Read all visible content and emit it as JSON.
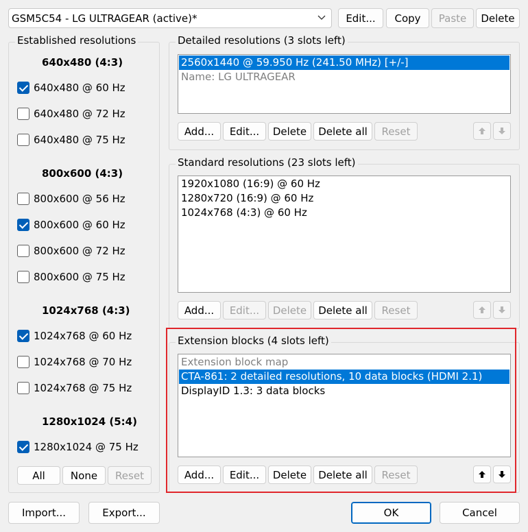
{
  "top": {
    "monitor_select": "GSM5C54 - LG ULTRAGEAR (active)*",
    "edit": "Edit...",
    "copy": "Copy",
    "paste": "Paste",
    "delete": "Delete"
  },
  "established": {
    "title": "Established resolutions",
    "groups": [
      {
        "heading": "640x480 (4:3)",
        "items": [
          {
            "label": "640x480 @ 60 Hz",
            "checked": true
          },
          {
            "label": "640x480 @ 72 Hz",
            "checked": false
          },
          {
            "label": "640x480 @ 75 Hz",
            "checked": false
          }
        ]
      },
      {
        "heading": "800x600 (4:3)",
        "items": [
          {
            "label": "800x600 @ 56 Hz",
            "checked": false
          },
          {
            "label": "800x600 @ 60 Hz",
            "checked": true
          },
          {
            "label": "800x600 @ 72 Hz",
            "checked": false
          },
          {
            "label": "800x600 @ 75 Hz",
            "checked": false
          }
        ]
      },
      {
        "heading": "1024x768 (4:3)",
        "items": [
          {
            "label": "1024x768 @ 60 Hz",
            "checked": true
          },
          {
            "label": "1024x768 @ 70 Hz",
            "checked": false
          },
          {
            "label": "1024x768 @ 75 Hz",
            "checked": false
          }
        ]
      },
      {
        "heading": "1280x1024 (5:4)",
        "items": [
          {
            "label": "1280x1024 @ 75 Hz",
            "checked": true
          }
        ]
      }
    ],
    "all": "All",
    "none": "None",
    "reset": "Reset"
  },
  "detailed": {
    "title": "Detailed resolutions (3 slots left)",
    "items": [
      "2560x1440 @ 59.950 Hz (241.50 MHz) [+/-]",
      "Name: LG ULTRAGEAR"
    ],
    "add": "Add...",
    "edit": "Edit...",
    "delete": "Delete",
    "delete_all": "Delete all",
    "reset": "Reset"
  },
  "standard": {
    "title": "Standard resolutions (23 slots left)",
    "items": [
      "1920x1080 (16:9) @ 60 Hz",
      "1280x720 (16:9) @ 60 Hz",
      "1024x768 (4:3) @ 60 Hz"
    ],
    "add": "Add...",
    "edit": "Edit...",
    "delete": "Delete",
    "delete_all": "Delete all",
    "reset": "Reset"
  },
  "extension": {
    "title": "Extension blocks (4 slots left)",
    "items": [
      "Extension block map",
      "CTA-861: 2 detailed resolutions, 10 data blocks (HDMI 2.1)",
      "DisplayID 1.3: 3 data blocks"
    ],
    "add": "Add...",
    "edit": "Edit...",
    "delete": "Delete",
    "delete_all": "Delete all",
    "reset": "Reset"
  },
  "bottom": {
    "import": "Import...",
    "export": "Export...",
    "ok": "OK",
    "cancel": "Cancel"
  },
  "colors": {
    "selection": "#0078d7",
    "highlight_box": "#e0262b",
    "checkbox": "#005fb8"
  }
}
